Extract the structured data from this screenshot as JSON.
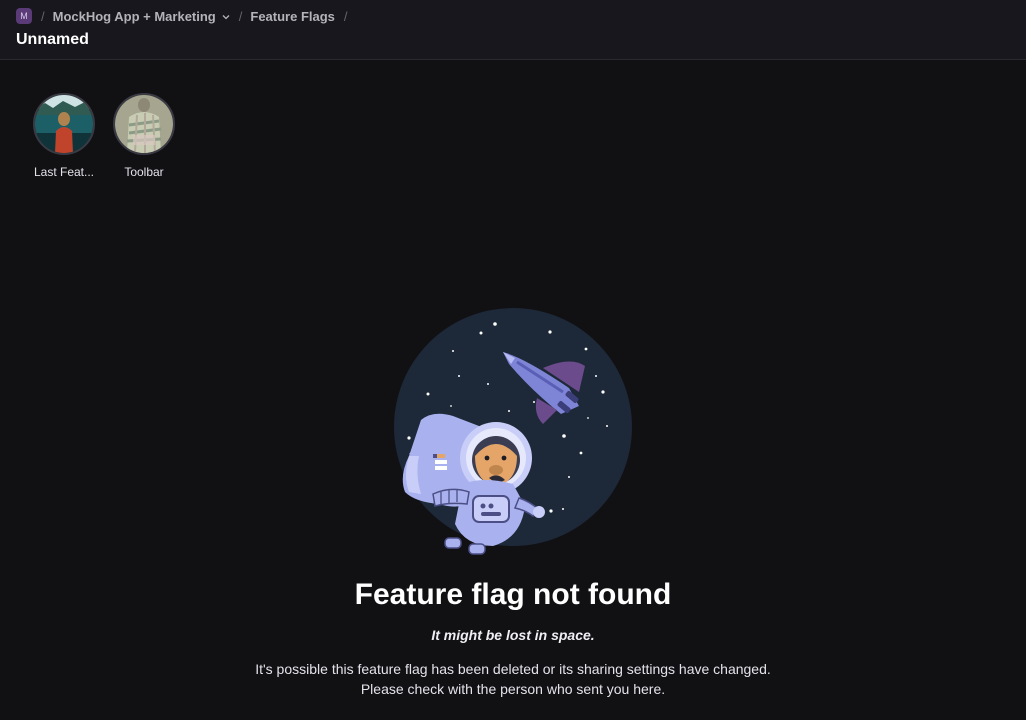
{
  "breadcrumb": {
    "project_badge": "M",
    "separator": "/",
    "project_name": "MockHog App + Marketing",
    "section": "Feature Flags"
  },
  "page": {
    "title": "Unnamed"
  },
  "notebooks": [
    {
      "label": "Last Feat..."
    },
    {
      "label": "Toolbar"
    }
  ],
  "not_found": {
    "title": "Feature flag not found",
    "subtitle": "It might be lost in space.",
    "line1": "It's possible this feature flag has been deleted or its sharing settings have changed.",
    "line2": "Please check with the person who sent you here."
  },
  "colors": {
    "background": "#111114",
    "topbar": "#18171d",
    "space": "#1d2838",
    "suit": "#a9b2ee"
  }
}
